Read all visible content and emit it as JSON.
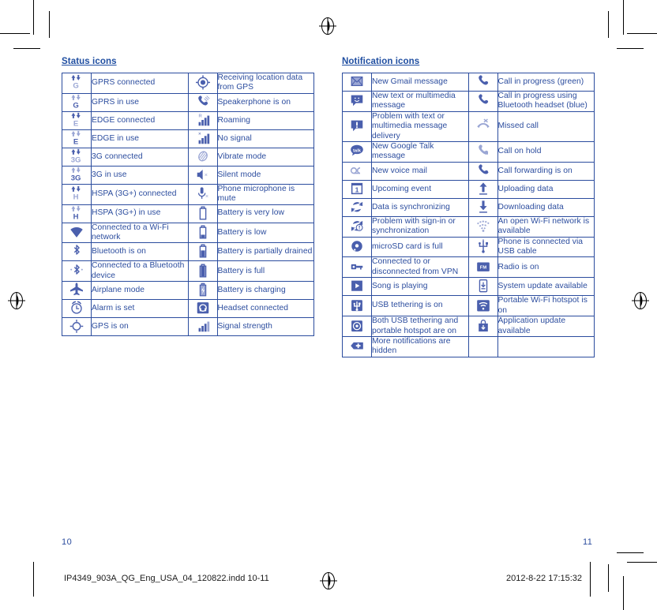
{
  "document": {
    "page_left": "10",
    "page_right": "11",
    "slug_file": "IP4349_903A_QG_Eng_USA_04_120822.indd   10-11",
    "slug_date": "2012-8-22   17:15:32",
    "text_color": "#2b4c9e",
    "border_color": "#2b4c9e",
    "icon_color": "#4a5fad",
    "icon_color_light": "#9aa6d4"
  },
  "status_panel": {
    "title": "Status icons",
    "rows": [
      {
        "icon_a": "gprs-connected-icon",
        "label_a": "GPRS connected",
        "icon_b": "gps-receiving-icon",
        "label_b": "Receiving location data from GPS"
      },
      {
        "icon_a": "gprs-in-use-icon",
        "label_a": "GPRS in use",
        "icon_b": "speakerphone-icon",
        "label_b": "Speakerphone is on"
      },
      {
        "icon_a": "edge-connected-icon",
        "label_a": "EDGE connected",
        "icon_b": "roaming-icon",
        "label_b": "Roaming"
      },
      {
        "icon_a": "edge-in-use-icon",
        "label_a": "EDGE in use",
        "icon_b": "no-signal-icon",
        "label_b": "No signal"
      },
      {
        "icon_a": "3g-connected-icon",
        "label_a": "3G connected",
        "icon_b": "vibrate-mode-icon",
        "label_b": "Vibrate mode"
      },
      {
        "icon_a": "3g-in-use-icon",
        "label_a": "3G in use",
        "icon_b": "silent-mode-icon",
        "label_b": "Silent mode"
      },
      {
        "icon_a": "hspa-connected-icon",
        "label_a": "HSPA (3G+) connected",
        "icon_b": "microphone-mute-icon",
        "label_b": "Phone microphone is mute"
      },
      {
        "icon_a": "hspa-in-use-icon",
        "label_a": "HSPA (3G+) in use",
        "icon_b": "battery-very-low-icon",
        "label_b": "Battery is very low"
      },
      {
        "icon_a": "wifi-connected-icon",
        "label_a": "Connected to a Wi-Fi network",
        "icon_b": "battery-low-icon",
        "label_b": "Battery is low"
      },
      {
        "icon_a": "bluetooth-on-icon",
        "label_a": "Bluetooth is on",
        "icon_b": "battery-partial-icon",
        "label_b": "Battery is partially drained"
      },
      {
        "icon_a": "bluetooth-connected-icon",
        "label_a": "Connected to a Bluetooth device",
        "icon_b": "battery-full-icon",
        "label_b": "Battery is full"
      },
      {
        "icon_a": "airplane-mode-icon",
        "label_a": "Airplane mode",
        "icon_b": "battery-charging-icon",
        "label_b": "Battery is charging"
      },
      {
        "icon_a": "alarm-set-icon",
        "label_a": "Alarm is set",
        "icon_b": "headset-connected-icon",
        "label_b": "Headset connected"
      },
      {
        "icon_a": "gps-on-icon",
        "label_a": "GPS is on",
        "icon_b": "signal-strength-icon",
        "label_b": "Signal strength"
      }
    ]
  },
  "notification_panel": {
    "title": "Notification icons",
    "rows": [
      {
        "icon_a": "new-gmail-icon",
        "label_a": "New Gmail message",
        "icon_b": "call-in-progress-icon",
        "label_b": "Call in progress (green)"
      },
      {
        "icon_a": "new-sms-icon",
        "label_a": "New text or multimedia message",
        "icon_b": "call-bluetooth-icon",
        "label_b": "Call in progress using Bluetooth headset (blue)"
      },
      {
        "icon_a": "sms-problem-icon",
        "label_a": "Problem with text or multimedia message delivery",
        "icon_b": "missed-call-icon",
        "label_b": "Missed call"
      },
      {
        "icon_a": "google-talk-icon",
        "label_a": "New Google Talk message",
        "icon_b": "call-on-hold-icon",
        "label_b": "Call on hold"
      },
      {
        "icon_a": "voicemail-icon",
        "label_a": "New voice mail",
        "icon_b": "call-forwarding-icon",
        "label_b": "Call forwarding is on"
      },
      {
        "icon_a": "upcoming-event-icon",
        "label_a": "Upcoming event",
        "icon_b": "uploading-data-icon",
        "label_b": "Uploading data"
      },
      {
        "icon_a": "data-sync-icon",
        "label_a": "Data is synchronizing",
        "icon_b": "downloading-data-icon",
        "label_b": "Downloading data"
      },
      {
        "icon_a": "sync-problem-icon",
        "label_a": "Problem with sign-in or synchronization",
        "icon_b": "open-wifi-icon",
        "label_b": "An open Wi-Fi network is available"
      },
      {
        "icon_a": "microsd-full-icon",
        "label_a": "microSD card is full",
        "icon_b": "usb-cable-icon",
        "label_b": "Phone is connected via USB cable"
      },
      {
        "icon_a": "vpn-icon",
        "label_a": "Connected to or disconnected from VPN",
        "icon_b": "fm-radio-icon",
        "label_b": "Radio is on"
      },
      {
        "icon_a": "song-playing-icon",
        "label_a": "Song is playing",
        "icon_b": "system-update-icon",
        "label_b": "System update available"
      },
      {
        "icon_a": "usb-tethering-icon",
        "label_a": "USB tethering is on",
        "icon_b": "portable-hotspot-icon",
        "label_b": "Portable Wi-Fi hotspot is on"
      },
      {
        "icon_a": "tethering-and-hotspot-icon",
        "label_a": "Both USB tethering and portable hotspot are on",
        "icon_b": "app-update-icon",
        "label_b": "Application update available"
      },
      {
        "icon_a": "more-notifications-icon",
        "label_a": "More notifications are hidden",
        "icon_b": "",
        "label_b": ""
      }
    ]
  }
}
